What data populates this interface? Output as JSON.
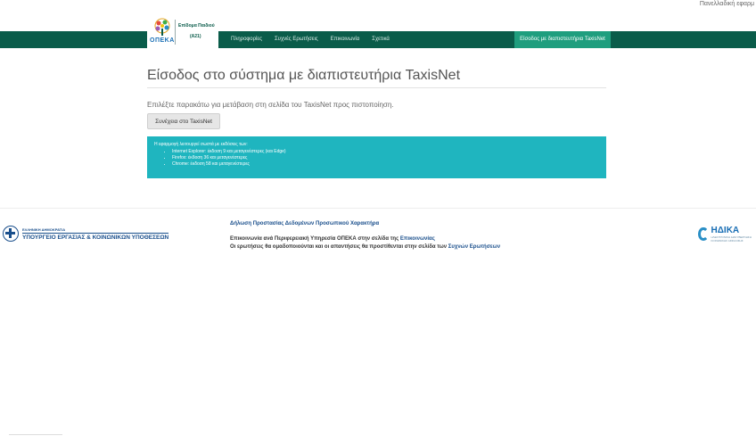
{
  "header": {
    "top_link": "Πανελλαδική εφαρμ",
    "logo": {
      "text": "ΟΠΕΚΑ",
      "sub1": "Επίδομα Παιδιού",
      "sub2": "(Α21)"
    },
    "nav": [
      {
        "label": "Πληροφορίες"
      },
      {
        "label": "Συχνές Ερωτήσεις"
      },
      {
        "label": "Επικοινωνία"
      },
      {
        "label": "Σχετικά"
      }
    ],
    "login_label": "Είσοδος με διαπιστευτήρια TaxisNet"
  },
  "main": {
    "title": "Είσοδος στο σύστημα με διαπιστευτήρια TaxisNet",
    "instructions": "Επιλέξτε παρακάτω για μετάβαση στη σελίδα του TaxisNet προς πιστοποίηση.",
    "continue_label": "Συνέχεια στο TaxisNet",
    "info": {
      "intro": "Η εφαρμογή λειτουργεί σωστά με εκδόσεις των:",
      "items": [
        "Internet Explorer: έκδοση 9 και μεταγενέστερες (και Edge)",
        "Firefox: έκδοση 36 και μεταγενέστερες",
        "Chrome: έκδοση 58 και μεταγενέστερες"
      ]
    }
  },
  "footer": {
    "ministry_small": "ΕΛΛΗΝΙΚΗ ΔΗΜΟΚΡΑΤΙΑ",
    "ministry_name": "ΥΠΟΥΡΓΕΙΟ ΕΡΓΑΣΙΑΣ & ΚΟΙΝΩΝΙΚΩΝ ΥΠΟΘΕΣΕΩΝ",
    "privacy": "Δήλωση Προστασίας Δεδομένων Προσωπικού Χαρακτήρα",
    "line1_text": "Επικοινωνία ανά Περιφερειακή Υπηρεσία ΟΠΕΚΑ στην σελίδα της ",
    "line1_link": "Επικοινωνίας",
    "line2_text": "Οι ερωτήσεις θα ομαδοποιούνται και οι απαντήσεις θα προστίθενται στην σελίδα των ",
    "line2_link": "Συχνών Ερωτήσεων",
    "idika_name": "ΗΔΙΚΑ",
    "idika_sub": "ΗΛΕΚΤΡΟΝΙΚΗ ΔΙΑΚΥΒΕΡΝΗΣΗ ΚΟΙΝΩΝΙΚΗΣ ΑΣΦΑΛΙΣΗΣ"
  },
  "colors": {
    "nav_bg": "#0a5c4a",
    "nav_login_bg": "#1f9e7e",
    "info_bg": "#1fb5bf",
    "link": "#1a4f8c"
  }
}
